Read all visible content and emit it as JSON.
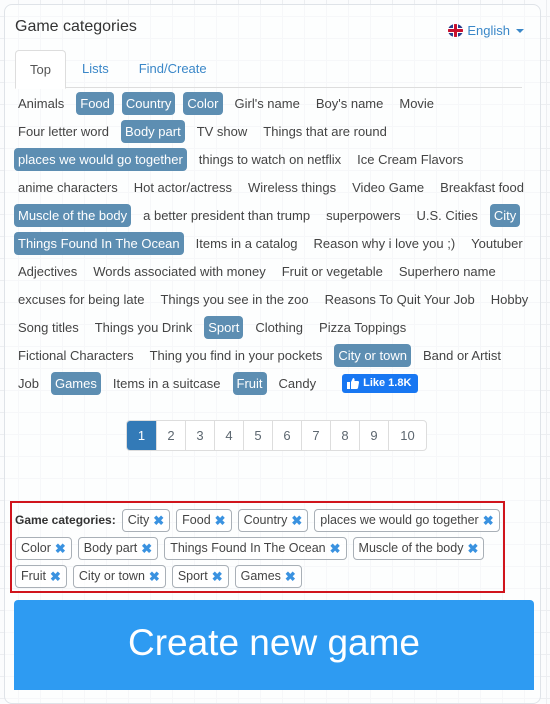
{
  "panel": {
    "title": "Game categories",
    "language": {
      "label": "English",
      "icon": "uk-flag-icon"
    }
  },
  "tabs": [
    {
      "label": "Top",
      "active": true
    },
    {
      "label": "Lists",
      "active": false
    },
    {
      "label": "Find/Create",
      "active": false
    }
  ],
  "categories": [
    {
      "label": "Animals",
      "selected": false
    },
    {
      "label": "Food",
      "selected": true
    },
    {
      "label": "Country",
      "selected": true
    },
    {
      "label": "Color",
      "selected": true
    },
    {
      "label": "Girl's name",
      "selected": false
    },
    {
      "label": "Boy's name",
      "selected": false
    },
    {
      "label": "Movie",
      "selected": false
    },
    {
      "label": "Four letter word",
      "selected": false
    },
    {
      "label": "Body part",
      "selected": true
    },
    {
      "label": "TV show",
      "selected": false
    },
    {
      "label": "Things that are round",
      "selected": false
    },
    {
      "label": "places we would go together",
      "selected": true
    },
    {
      "label": "things to watch on netflix",
      "selected": false
    },
    {
      "label": "Ice Cream Flavors",
      "selected": false
    },
    {
      "label": "anime characters",
      "selected": false
    },
    {
      "label": "Hot actor/actress",
      "selected": false
    },
    {
      "label": "Wireless things",
      "selected": false
    },
    {
      "label": "Video Game",
      "selected": false
    },
    {
      "label": "Breakfast food",
      "selected": false
    },
    {
      "label": "Muscle of the body",
      "selected": true
    },
    {
      "label": "a better president than trump",
      "selected": false
    },
    {
      "label": "superpowers",
      "selected": false
    },
    {
      "label": "U.S. Cities",
      "selected": false
    },
    {
      "label": "City",
      "selected": true
    },
    {
      "label": "Things Found In The Ocean",
      "selected": true
    },
    {
      "label": "Items in a catalog",
      "selected": false
    },
    {
      "label": "Reason why i love you ;)",
      "selected": false
    },
    {
      "label": "Youtuber",
      "selected": false
    },
    {
      "label": "Adjectives",
      "selected": false
    },
    {
      "label": "Words associated with money",
      "selected": false
    },
    {
      "label": "Fruit or vegetable",
      "selected": false
    },
    {
      "label": "Superhero name",
      "selected": false
    },
    {
      "label": "excuses for being late",
      "selected": false
    },
    {
      "label": "Things you see in the zoo",
      "selected": false
    },
    {
      "label": "Reasons To Quit Your Job",
      "selected": false
    },
    {
      "label": "Hobby",
      "selected": false
    },
    {
      "label": "Song titles",
      "selected": false
    },
    {
      "label": "Things you Drink",
      "selected": false
    },
    {
      "label": "Sport",
      "selected": true
    },
    {
      "label": "Clothing",
      "selected": false
    },
    {
      "label": "Pizza Toppings",
      "selected": false
    },
    {
      "label": "Fictional Characters",
      "selected": false
    },
    {
      "label": "Thing you find in your pockets",
      "selected": false
    },
    {
      "label": "City or town",
      "selected": true
    },
    {
      "label": "Band or Artist",
      "selected": false
    },
    {
      "label": "Job",
      "selected": false
    },
    {
      "label": "Games",
      "selected": true
    },
    {
      "label": "Items in a suitcase",
      "selected": false
    },
    {
      "label": "Fruit",
      "selected": true
    },
    {
      "label": "Candy",
      "selected": false
    }
  ],
  "like_button": {
    "label": "Like 1.8K",
    "icon": "thumbs-up-icon"
  },
  "pagination": {
    "pages": [
      "1",
      "2",
      "3",
      "4",
      "5",
      "6",
      "7",
      "8",
      "9",
      "10"
    ],
    "current": "1"
  },
  "selected_categories": {
    "label": "Game categories:",
    "remove_glyph": "✖",
    "items": [
      "City",
      "Food",
      "Country",
      "places we would go together",
      "Color",
      "Body part",
      "Things Found In The Ocean",
      "Muscle of the body",
      "Fruit",
      "City or town",
      "Sport",
      "Games"
    ]
  },
  "create_button": {
    "label": "Create new game"
  },
  "colors": {
    "selected_tag": "#5d8eb2",
    "link": "#3a87c8",
    "highlight_border": "#d0141c",
    "create_button": "#2e9bf2",
    "pager_active": "#337ab7",
    "facebook": "#1877f2"
  }
}
